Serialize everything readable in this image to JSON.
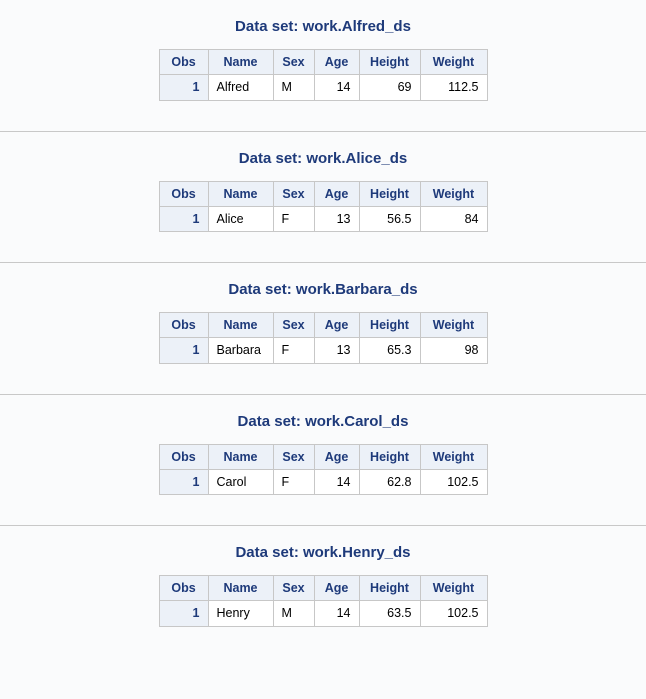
{
  "columns": {
    "obs": "Obs",
    "name": "Name",
    "sex": "Sex",
    "age": "Age",
    "height": "Height",
    "weight": "Weight"
  },
  "sections": [
    {
      "title": "Data set: work.Alfred_ds",
      "row": {
        "obs": "1",
        "name": "Alfred",
        "sex": "M",
        "age": "14",
        "height": "69",
        "weight": "112.5"
      }
    },
    {
      "title": "Data set: work.Alice_ds",
      "row": {
        "obs": "1",
        "name": "Alice",
        "sex": "F",
        "age": "13",
        "height": "56.5",
        "weight": "84"
      }
    },
    {
      "title": "Data set: work.Barbara_ds",
      "row": {
        "obs": "1",
        "name": "Barbara",
        "sex": "F",
        "age": "13",
        "height": "65.3",
        "weight": "98"
      }
    },
    {
      "title": "Data set: work.Carol_ds",
      "row": {
        "obs": "1",
        "name": "Carol",
        "sex": "F",
        "age": "14",
        "height": "62.8",
        "weight": "102.5"
      }
    },
    {
      "title": "Data set: work.Henry_ds",
      "row": {
        "obs": "1",
        "name": "Henry",
        "sex": "M",
        "age": "14",
        "height": "63.5",
        "weight": "102.5"
      }
    }
  ]
}
